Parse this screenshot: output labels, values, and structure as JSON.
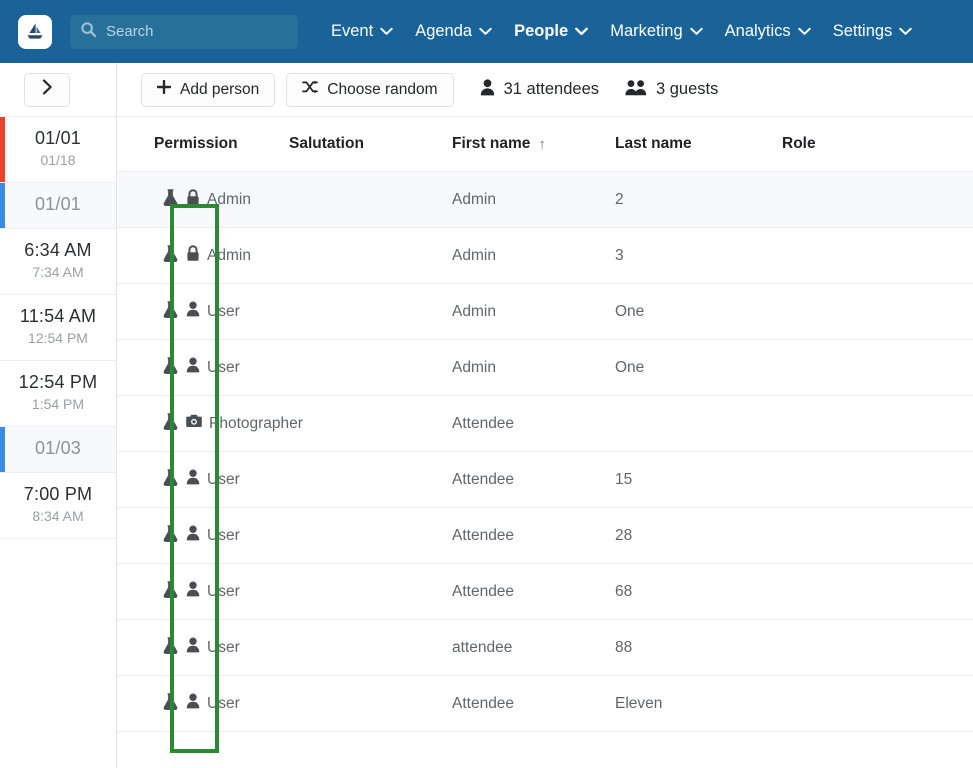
{
  "navbar": {
    "logo_icon": "sailboat-logo-icon",
    "search": {
      "value": "",
      "placeholder": "Search",
      "icon": "search-icon"
    },
    "menu": [
      {
        "label": "Event",
        "active": false,
        "caret": "chevron-down-icon"
      },
      {
        "label": "Agenda",
        "active": false,
        "caret": "chevron-down-icon"
      },
      {
        "label": "People",
        "active": true,
        "caret": "chevron-down-icon"
      },
      {
        "label": "Marketing",
        "active": false,
        "caret": "chevron-down-icon"
      },
      {
        "label": "Analytics",
        "active": false,
        "caret": "chevron-down-icon"
      },
      {
        "label": "Settings",
        "active": false,
        "caret": "chevron-down-icon"
      }
    ]
  },
  "sidebar": {
    "expand_button": {
      "icon": "chevron-right-icon",
      "label": ""
    },
    "slots": [
      {
        "primary": "01/01",
        "secondary": "01/18",
        "accent": "#e8452c",
        "muted": false,
        "tinted": false
      },
      {
        "primary": "01/01",
        "secondary": "",
        "accent": "#3b8ce8",
        "muted": true,
        "tinted": true
      },
      {
        "primary": "6:34 AM",
        "secondary": "7:34 AM",
        "accent": "",
        "muted": false,
        "tinted": false
      },
      {
        "primary": "11:54 AM",
        "secondary": "12:54 PM",
        "accent": "",
        "muted": false,
        "tinted": false
      },
      {
        "primary": "12:54 PM",
        "secondary": "1:54 PM",
        "accent": "",
        "muted": false,
        "tinted": false
      },
      {
        "primary": "01/03",
        "secondary": "",
        "accent": "#3b8ce8",
        "muted": true,
        "tinted": true
      },
      {
        "primary": "7:00 PM",
        "secondary": "8:34 AM",
        "accent": "",
        "muted": false,
        "tinted": false
      }
    ]
  },
  "toolbar": {
    "add_person": {
      "label": "Add person",
      "icon": "plus-icon"
    },
    "choose_random": {
      "label": "Choose random",
      "icon": "shuffle-icon"
    },
    "attendees": {
      "label": "31 attendees",
      "count": 31,
      "icon": "person-icon"
    },
    "guests": {
      "label": "3 guests",
      "count": 3,
      "icon": "people-icon"
    }
  },
  "table": {
    "columns": [
      {
        "label": "Permission",
        "sort": ""
      },
      {
        "label": "Salutation",
        "sort": ""
      },
      {
        "label": "First name",
        "sort": "↑"
      },
      {
        "label": "Last name",
        "sort": ""
      },
      {
        "label": "Role",
        "sort": ""
      }
    ],
    "rows": [
      {
        "flask_icon": "flask-icon",
        "perm_icon": "lock-icon",
        "permission": "Admin",
        "salutation": "",
        "first_name": "Admin",
        "last_name": "2",
        "role": "",
        "tinted": true
      },
      {
        "flask_icon": "flask-icon",
        "perm_icon": "lock-icon",
        "permission": "Admin",
        "salutation": "",
        "first_name": "Admin",
        "last_name": "3",
        "role": "",
        "tinted": false
      },
      {
        "flask_icon": "flask-icon",
        "perm_icon": "person-icon",
        "permission": "User",
        "salutation": "",
        "first_name": "Admin",
        "last_name": "One",
        "role": "",
        "tinted": false
      },
      {
        "flask_icon": "flask-icon",
        "perm_icon": "person-icon",
        "permission": "User",
        "salutation": "",
        "first_name": "Admin",
        "last_name": "One",
        "role": "",
        "tinted": false
      },
      {
        "flask_icon": "flask-icon",
        "perm_icon": "camera-icon",
        "permission": "Photographer",
        "salutation": "",
        "first_name": "Attendee",
        "last_name": "",
        "role": "",
        "tinted": false
      },
      {
        "flask_icon": "flask-icon",
        "perm_icon": "person-icon",
        "permission": "User",
        "salutation": "",
        "first_name": "Attendee",
        "last_name": "15",
        "role": "",
        "tinted": false
      },
      {
        "flask_icon": "flask-icon",
        "perm_icon": "person-icon",
        "permission": "User",
        "salutation": "",
        "first_name": "Attendee",
        "last_name": "28",
        "role": "",
        "tinted": false
      },
      {
        "flask_icon": "flask-icon",
        "perm_icon": "person-icon",
        "permission": "User",
        "salutation": "",
        "first_name": "Attendee",
        "last_name": "68",
        "role": "",
        "tinted": false
      },
      {
        "flask_icon": "flask-icon",
        "perm_icon": "person-icon",
        "permission": "User",
        "salutation": "",
        "first_name": "attendee",
        "last_name": "88",
        "role": "",
        "tinted": false
      },
      {
        "flask_icon": "flask-icon",
        "perm_icon": "person-icon",
        "permission": "User",
        "salutation": "",
        "first_name": "Attendee",
        "last_name": "Eleven",
        "role": "",
        "tinted": false
      }
    ]
  },
  "annotation": {
    "highlight_color": "#2a8a33",
    "target": "permission-icons-column"
  },
  "colors": {
    "navbar_bg": "#1a6398",
    "search_bg": "#27709a",
    "row_tint": "#f7f9fc",
    "accent_red": "#e8452c",
    "accent_blue": "#3b8ce8",
    "highlight_green": "#2a8a33"
  }
}
